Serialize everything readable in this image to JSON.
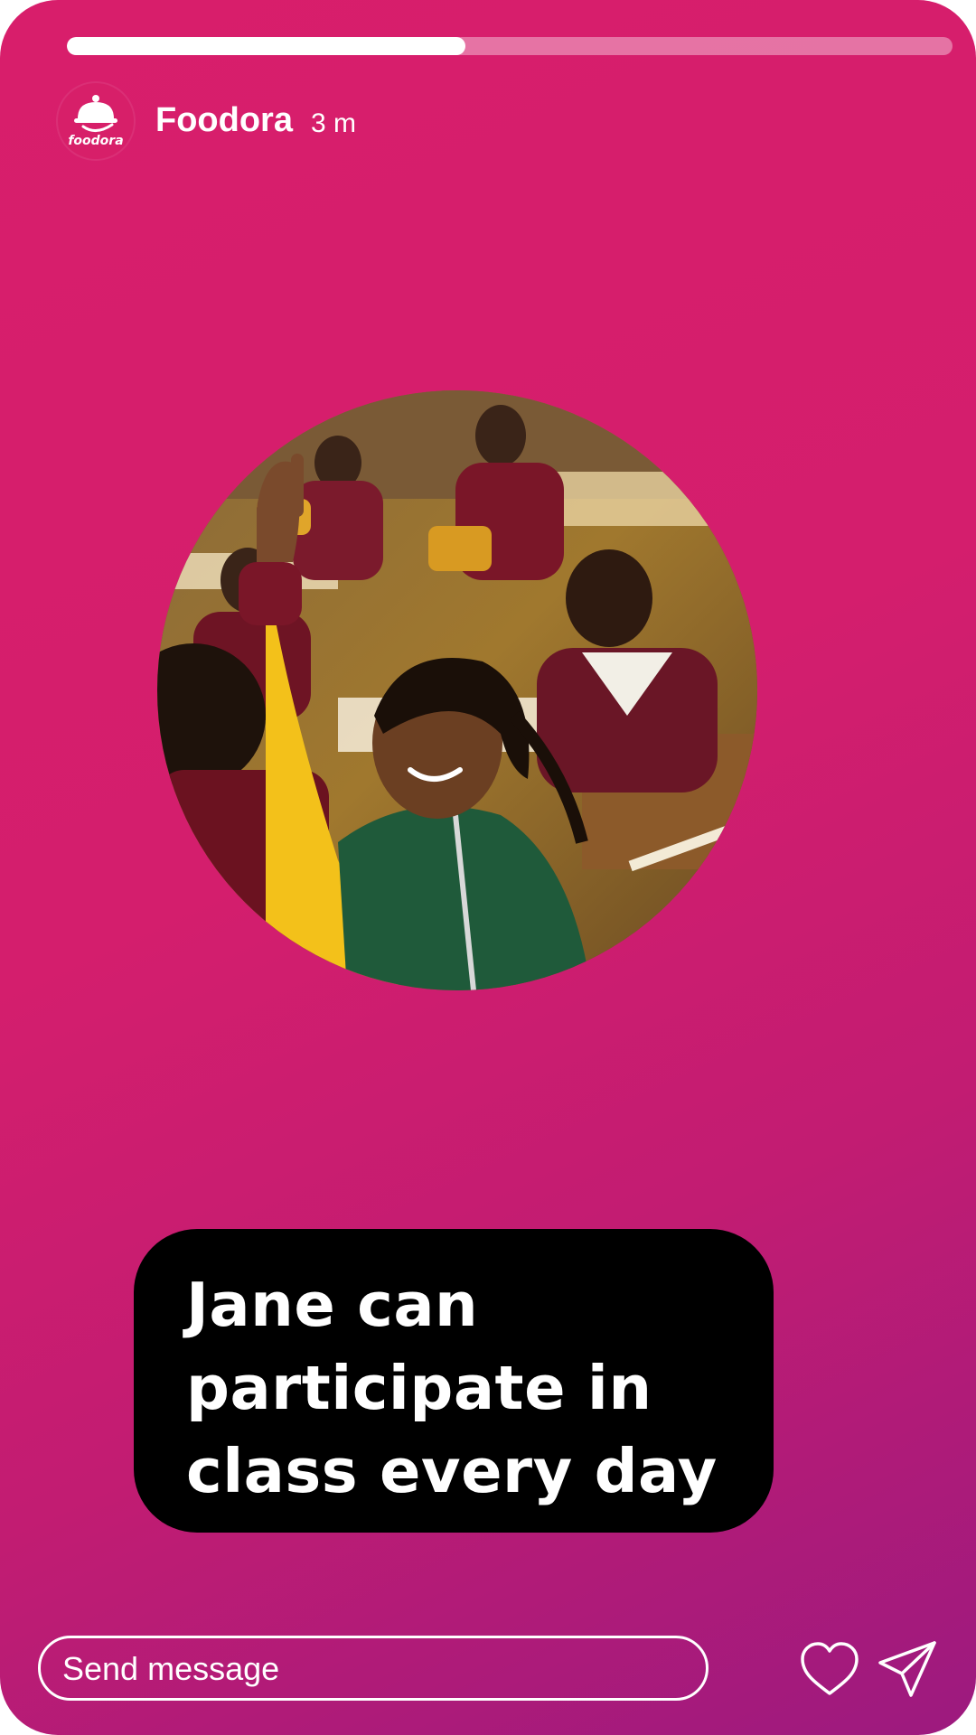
{
  "story": {
    "progress_fraction": 0.45,
    "account_name": "Foodora",
    "time_ago": "3 m",
    "avatar_logo_text": "foodora",
    "caption_text": "Jane can\nparticipate in\nclass  every day"
  },
  "message_bar": {
    "placeholder": "Send message"
  },
  "icons": {
    "like": "heart-icon",
    "share": "send-icon",
    "brand": "cloche-icon"
  },
  "colors": {
    "background_top": "#d81e6b",
    "background_bottom": "#9c1a7f",
    "caption_background": "#000000",
    "text": "#ffffff"
  }
}
